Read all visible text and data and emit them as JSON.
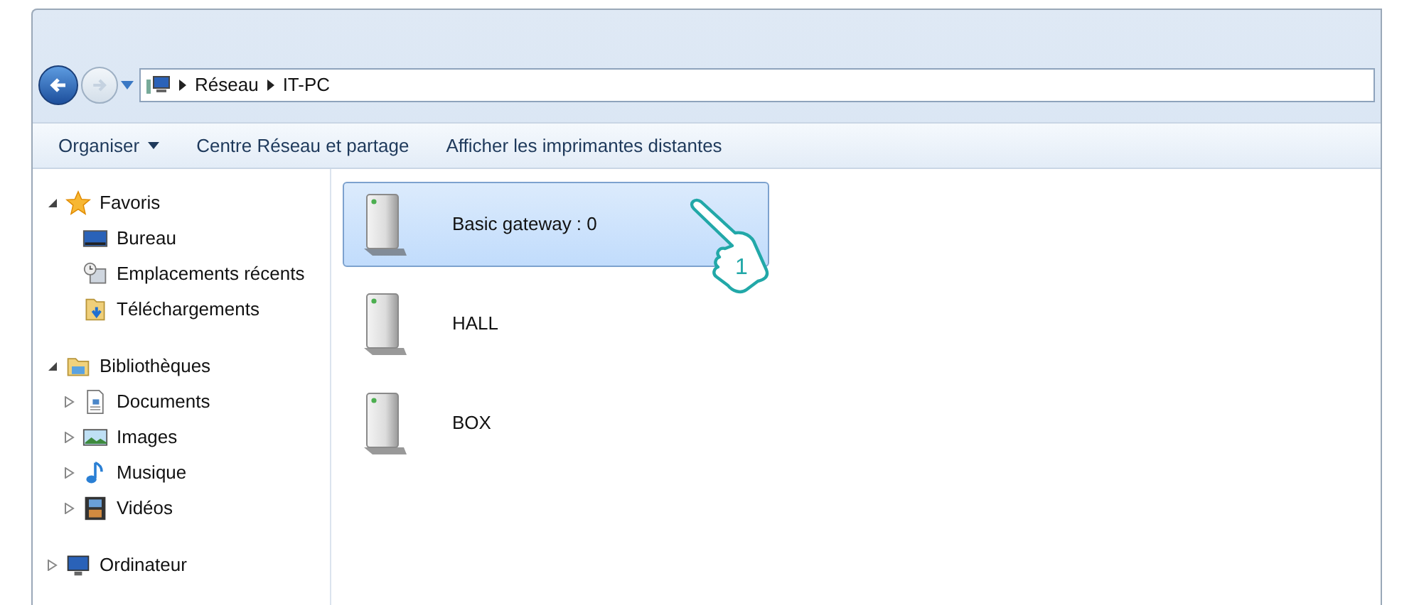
{
  "navigation": {
    "back_disabled": false,
    "forward_disabled": true
  },
  "breadcrumb": [
    "Réseau",
    "IT-PC"
  ],
  "toolbar": [
    {
      "label": "Organiser",
      "has_menu": true
    },
    {
      "label": "Centre Réseau et partage",
      "has_menu": false
    },
    {
      "label": "Afficher les imprimantes distantes",
      "has_menu": false
    }
  ],
  "sidebar": [
    {
      "label": "Favoris",
      "kind": "star",
      "expanded": true,
      "children": [
        {
          "label": "Bureau",
          "kind": "desktop"
        },
        {
          "label": "Emplacements récents",
          "kind": "recent"
        },
        {
          "label": "Téléchargements",
          "kind": "download"
        }
      ]
    },
    {
      "label": "Bibliothèques",
      "kind": "library",
      "expanded": true,
      "children": [
        {
          "label": "Documents",
          "kind": "document",
          "expanded": false
        },
        {
          "label": "Images",
          "kind": "picture",
          "expanded": false
        },
        {
          "label": "Musique",
          "kind": "music",
          "expanded": false
        },
        {
          "label": "Vidéos",
          "kind": "video",
          "expanded": false
        }
      ]
    },
    {
      "label": "Ordinateur",
      "kind": "computer",
      "expanded": false
    }
  ],
  "devices": [
    {
      "name": "Basic gateway : 0",
      "selected": true
    },
    {
      "name": "HALL",
      "selected": false
    },
    {
      "name": "BOX",
      "selected": false
    }
  ],
  "callout": {
    "label": "1"
  }
}
